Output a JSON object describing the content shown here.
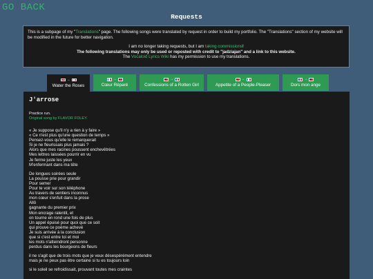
{
  "nav": {
    "go_back": "GO BACK"
  },
  "page_title": "Requests",
  "intro": {
    "p1_a": "This is a subpage of my \"",
    "p1_link": "Translations",
    "p1_b": "\" page. The following songs were translated by request in order to build my portfolio. The \"Translations\" section of my website will be modified in the future for better navigation.",
    "p2_a": "I am no longer taking requests, but I am ",
    "p2_link": "taking commissions",
    "p2_b": "!",
    "p3": "The following translations may only be used or reposted with credit to \"jadziajan\" and a link to this website.",
    "p4_a": "The ",
    "p4_link": "Vocaloid Lyrics Wiki",
    "p4_b": " has my permission to use my translations."
  },
  "tabs": [
    {
      "label": "Water the Roses",
      "from": "uk-flag-icon",
      "to": "fr-flag-icon",
      "active": true
    },
    {
      "label": "Cœur Réparé",
      "from": "fr-flag-icon",
      "to": "uk-flag-icon",
      "active": false
    },
    {
      "label": "Confessions of a Rotten Girl",
      "from": "uk-flag-icon",
      "to": "fr-flag-icon",
      "active": false
    },
    {
      "label": "Appetite of a People-Pleaser",
      "from": "uk-flag-icon",
      "to": "fr-flag-icon",
      "active": false
    },
    {
      "label": "Dors mon ange",
      "from": "fr-flag-icon",
      "to": "uk-flag-icon",
      "active": false
    }
  ],
  "colors": {
    "background": "#3f5c78",
    "panel": "#1a1a1a",
    "accent": "#36b36a",
    "tab": "#2e9a54"
  },
  "song": {
    "title": "J'arrose",
    "note1": "Practice run.",
    "note2": "Original song by FLAVOR FOLEY.",
    "stanzas": [
      [
        "« Je suppose qu'il n'y a rien à y faire »",
        "« Ce n'est plus qu'une question de temps »",
        "Pensez-vous qu'elle le remarquerait",
        "Si je ne fleurissais plus jamais ?",
        "Alors que mes racines poussent enchevêtrées",
        "Mes lettres laissées pourrir en vu",
        "Je ferme juste les yeux",
        "M'enfermant dans ma tête"
      ],
      [
        "De longues soirées seule",
        "La pousse prie pour grandir",
        "Pour semer",
        "Pour te voir sur son téléphone",
        "Au travers de sentiers inconnus",
        "mon cœur s'enfuit dans la prose",
        "Allô",
        "gagnante du premier prix",
        "Mon encrage ralentit, et",
        "on tourne en rond une fois de plus",
        "Un appel épuisé pour quoi que ce soit",
        "qui prouve ce poème achevé",
        "Je suis arrivée à la conclusion",
        "que si c'est entre toi et moi",
        "les mots n'atteindront personne",
        "perdus dans les bourgeons de fleurs"
      ],
      [
        "il ne s'agit que de trois mots que je veux désespérément entendre",
        "mais je ne peux pas être certaine si tu es toujours loin"
      ],
      [
        "si le soleil se refroidissait, prouvant toutes mes craintes"
      ]
    ]
  }
}
